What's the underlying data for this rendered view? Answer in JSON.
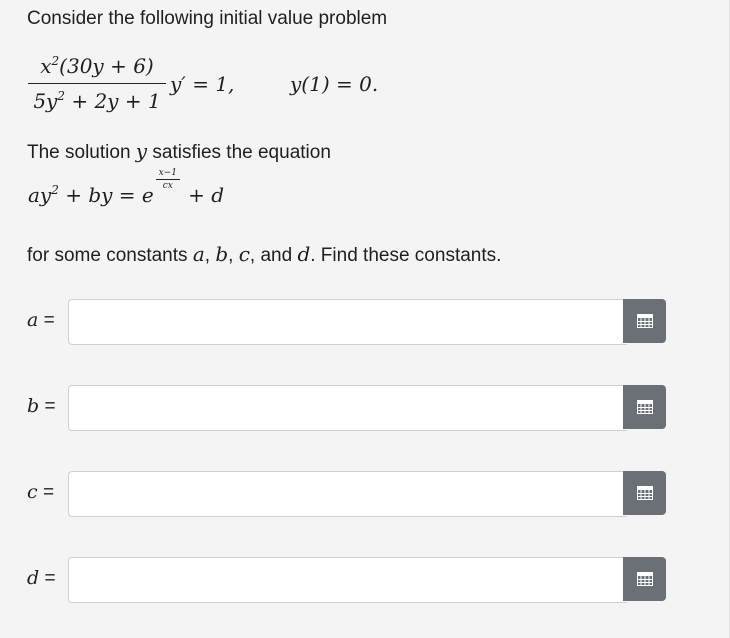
{
  "intro": "Consider the following initial value problem",
  "ode": {
    "numerator": "x²(30y + 6)",
    "denominator": "5y² + 2y + 1",
    "rhs": "y′ = 1,",
    "initial_condition": "y(1) = 0."
  },
  "solution_text": "The solution",
  "solution_var": "y",
  "solution_rest": "satisfies the equation",
  "equation": {
    "lhs": "ay² + by = e",
    "exp_num": "x−1",
    "exp_den": "cx",
    "tail": "+ d"
  },
  "constants_text": {
    "prefix": "for some constants",
    "a": "a",
    "b": "b",
    "c": "c",
    "d": "d",
    "and": "and",
    "suffix": ". Find these constants."
  },
  "fields": [
    {
      "var": "a",
      "eq": "=",
      "value": "",
      "button_icon": "calculator-grid-icon"
    },
    {
      "var": "b",
      "eq": "=",
      "value": "",
      "button_icon": "calculator-grid-icon"
    },
    {
      "var": "c",
      "eq": "=",
      "value": "",
      "button_icon": "calculator-grid-icon"
    },
    {
      "var": "d",
      "eq": "=",
      "value": "",
      "button_icon": "calculator-grid-icon"
    }
  ],
  "colors": {
    "panel_bg": "#f4f4f4",
    "button_bg": "#6b7076",
    "input_border": "#cfcfcf"
  }
}
